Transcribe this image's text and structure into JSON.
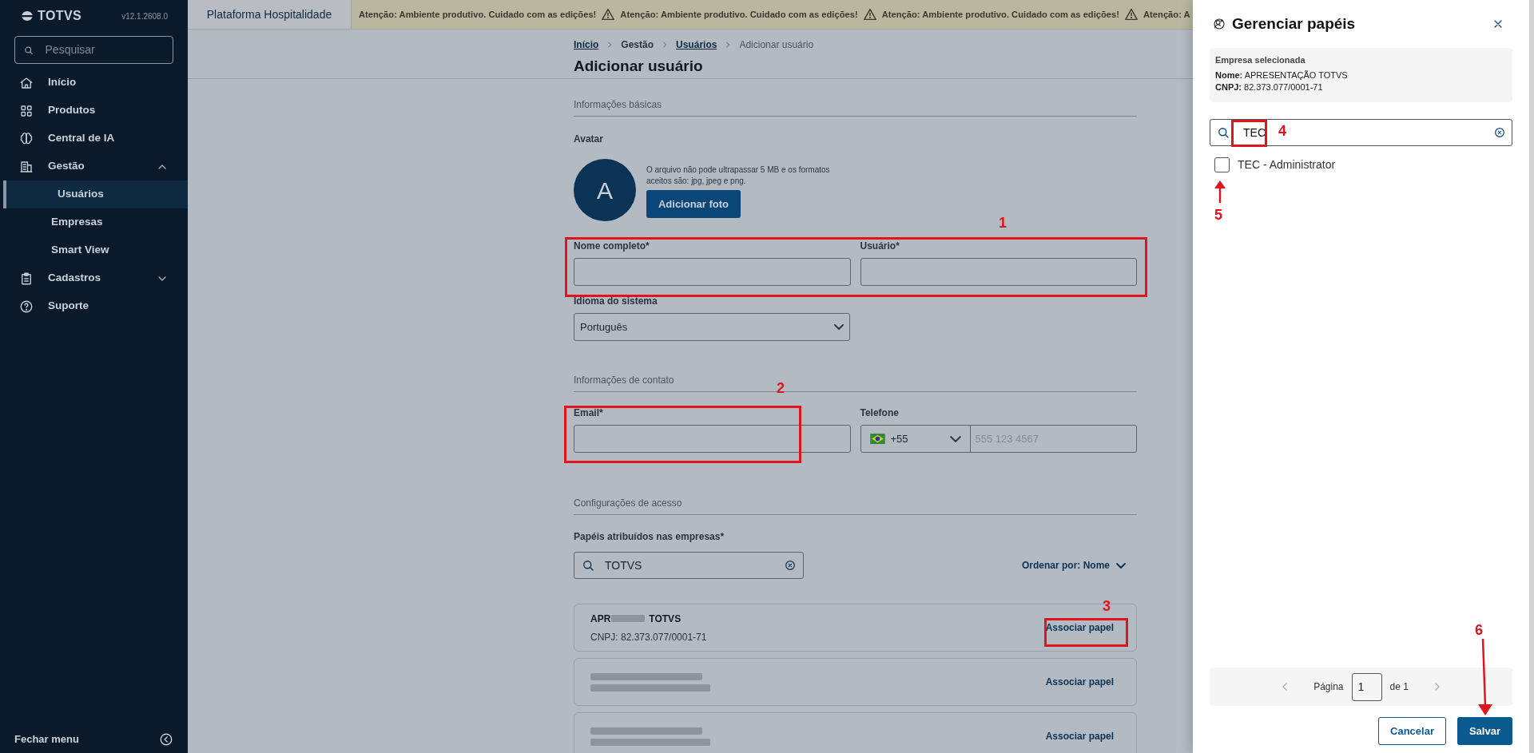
{
  "sidebar": {
    "logo": "TOTVS",
    "version": "v12.1.2608.0",
    "search": {
      "placeholder": "Pesquisar"
    },
    "items": [
      {
        "label": "Início",
        "kind": "home"
      },
      {
        "label": "Produtos",
        "kind": "grid"
      },
      {
        "label": "Central de IA",
        "kind": "brain"
      },
      {
        "label": "Gestão",
        "kind": "building",
        "expanded": true,
        "children": [
          {
            "label": "Usuários",
            "selected": true
          },
          {
            "label": "Empresas",
            "selected": false
          },
          {
            "label": "Smart View",
            "selected": false
          }
        ]
      },
      {
        "label": "Cadastros",
        "kind": "clipboard",
        "expanded": false
      },
      {
        "label": "Suporte",
        "kind": "help"
      }
    ],
    "footer": "Fechar menu"
  },
  "topbar": {
    "tab": "Plataforma Hospitalidade",
    "banner": [
      "Atenção: Ambiente produtivo. Cuidado com as edições!",
      "Atenção: Ambiente produtivo. Cuidado com as edições!",
      "Atenção: Ambiente produtivo. Cuidado com as edições!",
      "Atenção: A"
    ]
  },
  "breadcrumb": [
    {
      "label": "Início",
      "kind": "link"
    },
    {
      "label": "Gestão",
      "kind": "text"
    },
    {
      "label": "Usuários",
      "kind": "link"
    },
    {
      "label": "Adicionar usuário",
      "kind": "current"
    }
  ],
  "title": "Adicionar usuário",
  "basic": {
    "heading": "Informações básicas",
    "avatar_label": "Avatar",
    "avatar_initial": "A",
    "avatar_hint": "O arquivo não pode ultrapassar 5 MB e os formatos aceitos são: jpg, jpeg e png.",
    "add_photo": "Adicionar foto",
    "fields": [
      {
        "label": "Nome completo*"
      },
      {
        "label": "Usuário*"
      }
    ],
    "language": {
      "label": "Idioma do sistema",
      "value": "Português"
    }
  },
  "contact": {
    "heading": "Informações de contato",
    "email": {
      "label": "Email*"
    },
    "phone": {
      "label": "Telefone",
      "country_code": "+55",
      "placeholder": "555 123 4567"
    }
  },
  "access": {
    "heading": "Configurações de acesso",
    "roles_label": "Papéis atribuídos nas empresas*",
    "search": {
      "value": "TOTVS"
    },
    "sort": "Ordenar por: Nome",
    "companies": [
      {
        "kind": "partly_redacted",
        "name_start": "APR",
        "name_end": "TOTVS",
        "cnpj": "CNPJ: 82.373.077/0001-71",
        "action": "Associar papel"
      },
      {
        "kind": "redacted",
        "action": "Associar papel"
      },
      {
        "kind": "redacted",
        "action": "Associar papel"
      }
    ]
  },
  "panel": {
    "title": "Gerenciar papéis",
    "company": {
      "heading": "Empresa selecionada",
      "name": "**Nome:** APRESENTAÇÃO TOTVS",
      "cnpj": "**CNPJ:** 82.373.077/0001-71"
    },
    "search": {
      "value": "TEC"
    },
    "roles": [
      {
        "label": "TEC - Administrator",
        "checked": false
      }
    ],
    "pagination": {
      "label": "Página",
      "page": "1",
      "of": "de 1"
    },
    "buttons": [
      {
        "label": "Cancelar",
        "kind": "secondary"
      },
      {
        "label": "Salvar",
        "kind": "primary"
      }
    ]
  },
  "annotations": [
    {
      "label": "1",
      "kind": "box"
    },
    {
      "label": "2",
      "kind": "box"
    },
    {
      "label": "3",
      "kind": "box"
    },
    {
      "label": "4",
      "kind": "box"
    },
    {
      "label": "5",
      "kind": "arrow"
    },
    {
      "label": "6",
      "kind": "arrow"
    }
  ]
}
